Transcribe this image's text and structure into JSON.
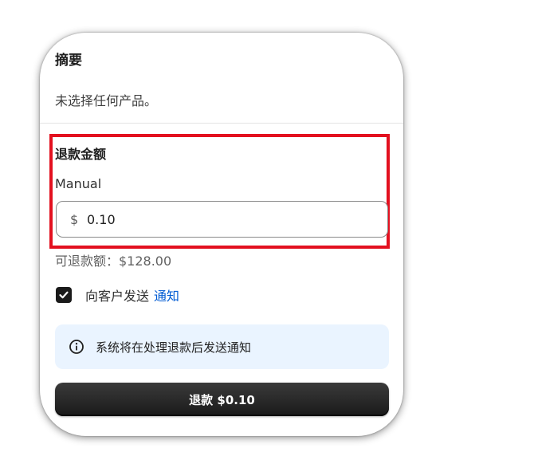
{
  "summary": {
    "title": "摘要",
    "text": "未选择任何产品。"
  },
  "refund": {
    "title": "退款金额",
    "method_label": "Manual",
    "currency_symbol": "$",
    "amount_value": "0.10",
    "refundable_text": "可退款额：$128.00"
  },
  "notification": {
    "checked": true,
    "label": "向客户发送",
    "link_text": "通知"
  },
  "banner": {
    "icon": "info-icon",
    "text": "系统将在处理退款后发送通知"
  },
  "actions": {
    "refund_button_label": "退款 $0.10"
  },
  "colors": {
    "highlight_border": "#e3101f",
    "link": "#005bd3",
    "banner_bg": "#eaf4ff",
    "primary_button": "#1a1a1a"
  }
}
